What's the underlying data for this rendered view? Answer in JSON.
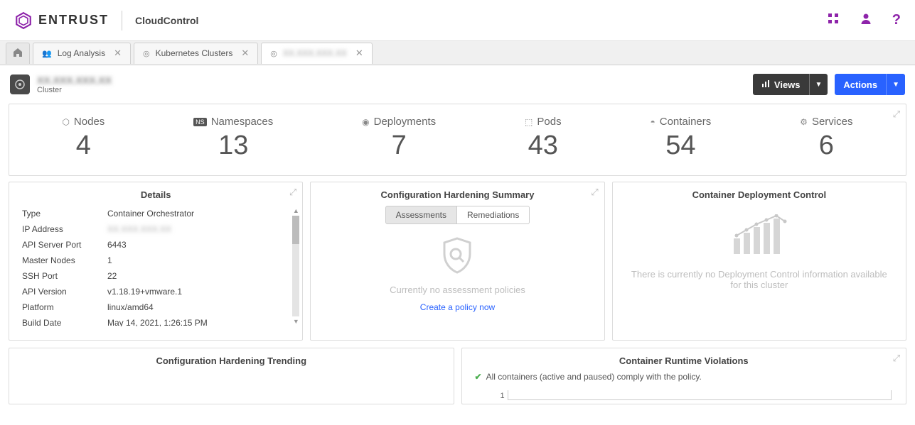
{
  "brand": {
    "name": "ENTRUST",
    "product": "CloudControl"
  },
  "tabs": {
    "log_analysis": "Log Analysis",
    "k8s_clusters": "Kubernetes Clusters",
    "obscured": "XX.XXX.XXX.XX"
  },
  "page": {
    "title_obscured": "XX.XXX.XXX.XX",
    "subtitle": "Cluster",
    "views_label": "Views",
    "actions_label": "Actions"
  },
  "stats": {
    "nodes": {
      "label": "Nodes",
      "value": "4"
    },
    "namespaces": {
      "label": "Namespaces",
      "value": "13"
    },
    "deployments": {
      "label": "Deployments",
      "value": "7"
    },
    "pods": {
      "label": "Pods",
      "value": "43"
    },
    "containers": {
      "label": "Containers",
      "value": "54"
    },
    "services": {
      "label": "Services",
      "value": "6"
    }
  },
  "details": {
    "title": "Details",
    "rows": {
      "type": {
        "k": "Type",
        "v": "Container Orchestrator"
      },
      "ip": {
        "k": "IP Address",
        "v": "XX.XXX.XXX.XX"
      },
      "api_port": {
        "k": "API Server Port",
        "v": "6443"
      },
      "master": {
        "k": "Master Nodes",
        "v": "1"
      },
      "ssh": {
        "k": "SSH Port",
        "v": "22"
      },
      "api_ver": {
        "k": "API Version",
        "v": "v1.18.19+vmware.1"
      },
      "platform": {
        "k": "Platform",
        "v": "linux/amd64"
      },
      "build": {
        "k": "Build Date",
        "v": "May 14, 2021, 1:26:15 PM"
      }
    }
  },
  "hardening": {
    "title": "Configuration Hardening Summary",
    "tab_assess": "Assessments",
    "tab_remed": "Remediations",
    "empty_text": "Currently no assessment policies",
    "empty_link": "Create a policy now"
  },
  "deploy_control": {
    "title": "Container Deployment Control",
    "empty_text": "There is currently no Deployment Control information available for this cluster"
  },
  "trending": {
    "title": "Configuration Hardening Trending"
  },
  "violations": {
    "title": "Container Runtime Violations",
    "comply_text": "All containers (active and paused) comply with the policy.",
    "axis_tick": "1"
  }
}
